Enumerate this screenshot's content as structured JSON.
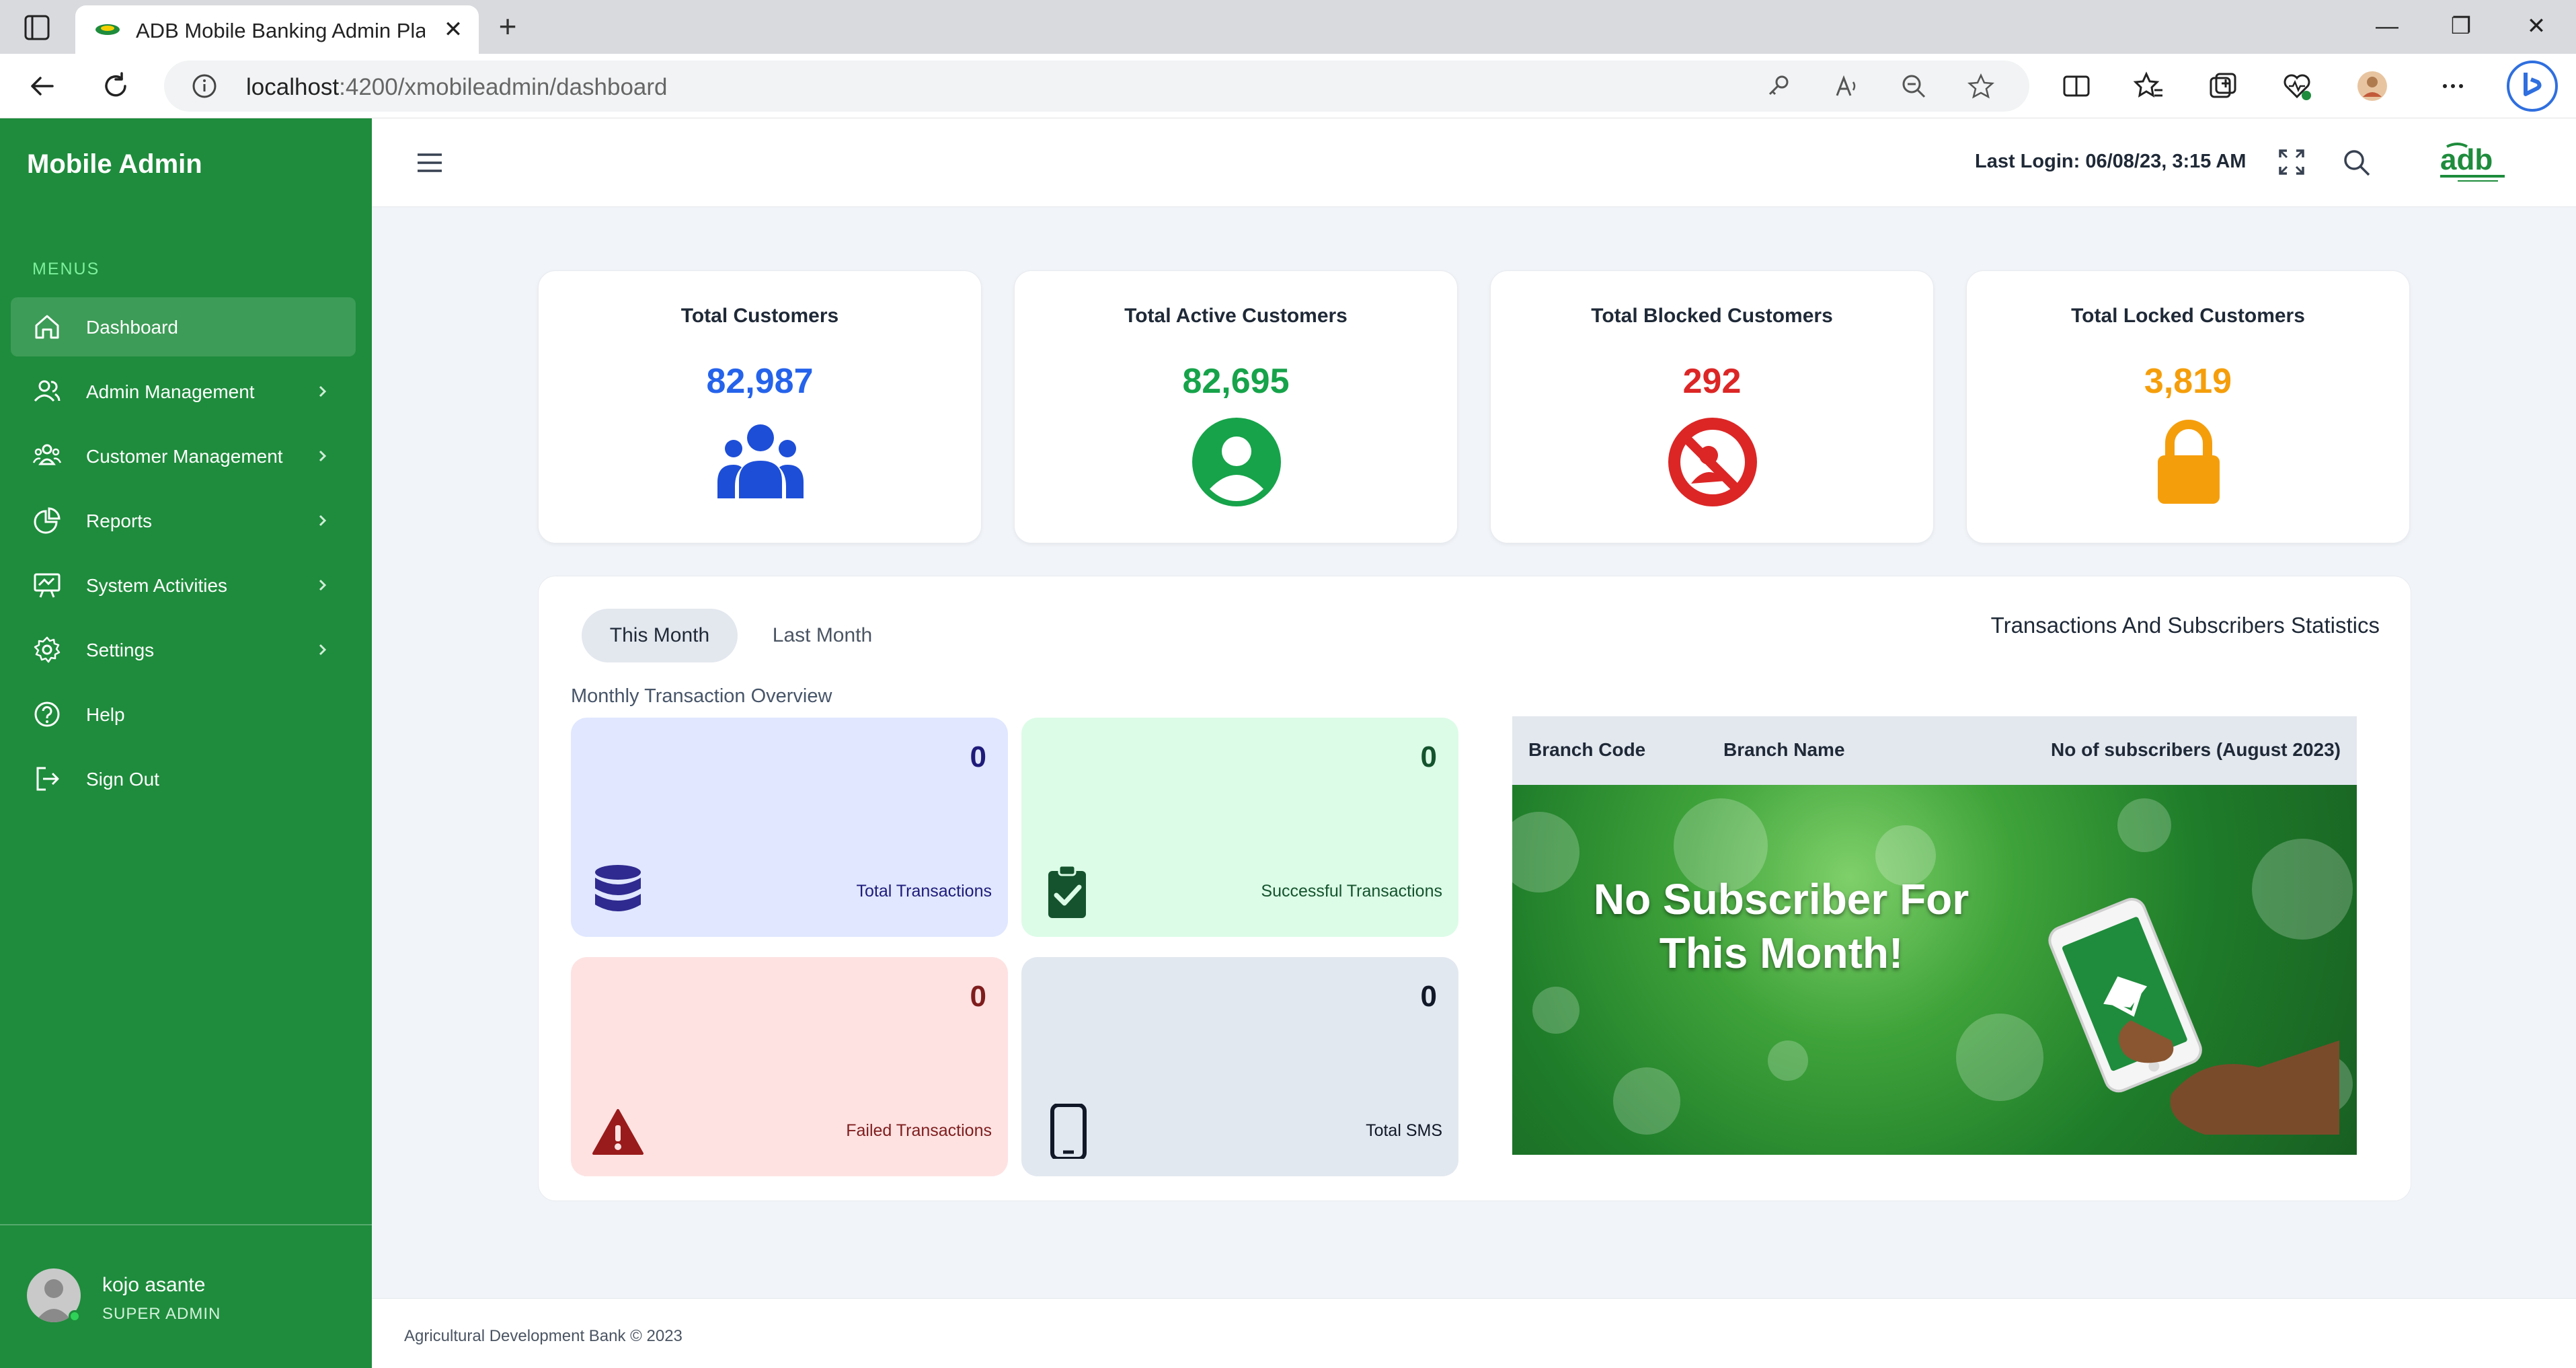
{
  "browser": {
    "tab_title": "ADB Mobile Banking Admin Platf",
    "tab_close": "✕",
    "new_tab": "+",
    "url_host": "localhost",
    "url_path": ":4200/xmobileadmin/dashboard",
    "window_controls": {
      "minimize": "—",
      "restore": "❐",
      "close": "✕"
    }
  },
  "sidebar": {
    "brand": "Mobile Admin",
    "menus_label": "MENUS",
    "items": [
      {
        "label": "Dashboard",
        "icon": "home-icon",
        "active": true,
        "chevron": false
      },
      {
        "label": "Admin Management",
        "icon": "users-icon",
        "active": false,
        "chevron": true
      },
      {
        "label": "Customer Management",
        "icon": "group-icon",
        "active": false,
        "chevron": true
      },
      {
        "label": "Reports",
        "icon": "pie-chart-icon",
        "active": false,
        "chevron": true
      },
      {
        "label": "System Activities",
        "icon": "activity-board-icon",
        "active": false,
        "chevron": true
      },
      {
        "label": "Settings",
        "icon": "gear-icon",
        "active": false,
        "chevron": true
      },
      {
        "label": "Help",
        "icon": "help-circle-icon",
        "active": false,
        "chevron": false
      },
      {
        "label": "Sign Out",
        "icon": "sign-out-icon",
        "active": false,
        "chevron": false
      }
    ],
    "user": {
      "name": "kojo asante",
      "role": "SUPER ADMIN"
    }
  },
  "header": {
    "last_login": "Last Login: 06/08/23, 3:15 AM",
    "logo_text": "adb"
  },
  "stats": [
    {
      "title": "Total Customers",
      "value": "82,987",
      "color": "#2563eb",
      "icon": "customers-group-icon"
    },
    {
      "title": "Total Active Customers",
      "value": "82,695",
      "color": "#16a34a",
      "icon": "user-circle-icon"
    },
    {
      "title": "Total Blocked Customers",
      "value": "292",
      "color": "#dc2626",
      "icon": "blocked-icon"
    },
    {
      "title": "Total Locked Customers",
      "value": "3,819",
      "color": "#f59e0b",
      "icon": "lock-icon"
    }
  ],
  "panel": {
    "tabs": [
      "This Month",
      "Last Month"
    ],
    "title": "Transactions And Subscribers Statistics",
    "overview_label": "Monthly Transaction Overview",
    "mini_cards": [
      {
        "label": "Total Transactions",
        "value": "0",
        "bg": "#e0e7ff",
        "fg": "#1e1b7a",
        "icon": "database-icon"
      },
      {
        "label": "Successful Transactions",
        "value": "0",
        "bg": "#dcfce7",
        "fg": "#14532d",
        "icon": "clipboard-check-icon"
      },
      {
        "label": "Failed Transactions",
        "value": "0",
        "bg": "#fee2e2",
        "fg": "#7f1d1d",
        "icon": "warning-icon"
      },
      {
        "label": "Total SMS",
        "value": "0",
        "bg": "#e2e8f0",
        "fg": "#111827",
        "icon": "mobile-icon"
      }
    ],
    "table_headers": [
      "Branch Code",
      "Branch Name",
      "No of subscribers (August 2023)"
    ],
    "empty_message_line1": "No Subscriber For",
    "empty_message_line2": "This Month!"
  },
  "footer": {
    "text": "Agricultural Development Bank © 2023"
  }
}
